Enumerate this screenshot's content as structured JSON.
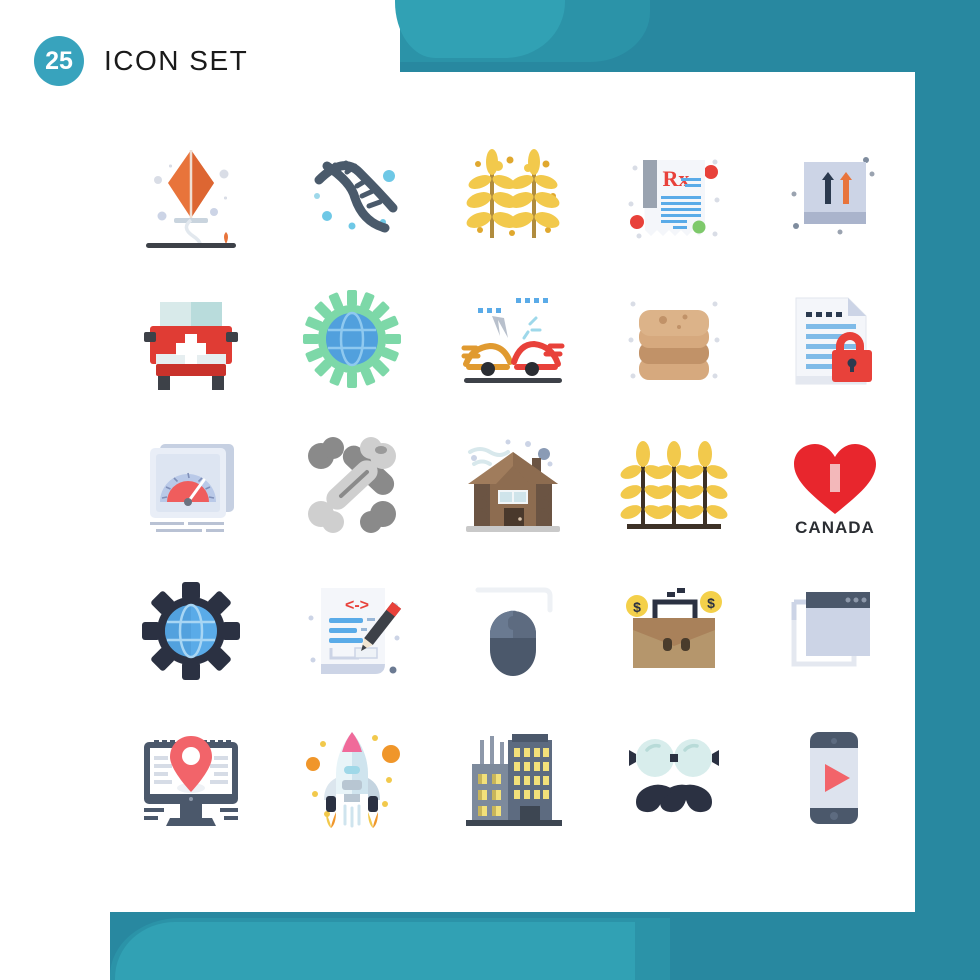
{
  "header": {
    "count": "25",
    "title": "ICON SET",
    "badge_color": "#38a3bd",
    "title_color": "#1a1a1a"
  },
  "decoration": {
    "teal_dark": "#2888a0",
    "teal_mid": "#2b93a8",
    "teal_light": "#31a1b4"
  },
  "grid": {
    "rows": 5,
    "columns": 5,
    "total": 25,
    "icons": [
      {
        "name": "kite-icon",
        "label": "Kite"
      },
      {
        "name": "dna-icon",
        "label": "DNA"
      },
      {
        "name": "wheat-two-stalks-icon",
        "label": "Wheat"
      },
      {
        "name": "prescription-rx-icon",
        "label": "Prescription"
      },
      {
        "name": "up-arrows-box-icon",
        "label": "This Side Up"
      },
      {
        "name": "ambulance-icon",
        "label": "Ambulance"
      },
      {
        "name": "gear-globe-green-icon",
        "label": "Global Settings"
      },
      {
        "name": "car-accident-icon",
        "label": "Car Accident"
      },
      {
        "name": "pancakes-icon",
        "label": "Pancakes"
      },
      {
        "name": "document-lock-icon",
        "label": "Secure Document"
      },
      {
        "name": "speedometer-icon",
        "label": "Speedometer"
      },
      {
        "name": "crossed-bones-icon",
        "label": "Bones"
      },
      {
        "name": "log-cabin-icon",
        "label": "Log Cabin"
      },
      {
        "name": "wheat-field-icon",
        "label": "Wheat Field"
      },
      {
        "name": "canada-heart-icon",
        "label": "I Love Canada",
        "text": "CANADA"
      },
      {
        "name": "gear-globe-dark-icon",
        "label": "Settings Globe"
      },
      {
        "name": "code-document-pencil-icon",
        "label": "Code Editing"
      },
      {
        "name": "computer-mouse-icon",
        "label": "Mouse"
      },
      {
        "name": "briefcase-money-icon",
        "label": "Business Money"
      },
      {
        "name": "browser-window-icon",
        "label": "Browser Window"
      },
      {
        "name": "desktop-location-icon",
        "label": "Desktop Location"
      },
      {
        "name": "rocket-launch-icon",
        "label": "Rocket"
      },
      {
        "name": "office-buildings-icon",
        "label": "Office Buildings"
      },
      {
        "name": "hipster-mustache-glasses-icon",
        "label": "Hipster"
      },
      {
        "name": "smartphone-play-icon",
        "label": "Mobile Video"
      }
    ]
  },
  "palette": {
    "orange": "#e8743b",
    "navy": "#2b3a4f",
    "slate": "#5b6b7c",
    "yellow": "#f2c94c",
    "gold": "#e0a82e",
    "red": "#e8413a",
    "blue": "#5aabe8",
    "light_blue": "#ccd4e6",
    "green": "#7dd8a8",
    "brown": "#a9815a",
    "tan": "#d6a97e",
    "gray": "#9a9a9a"
  }
}
